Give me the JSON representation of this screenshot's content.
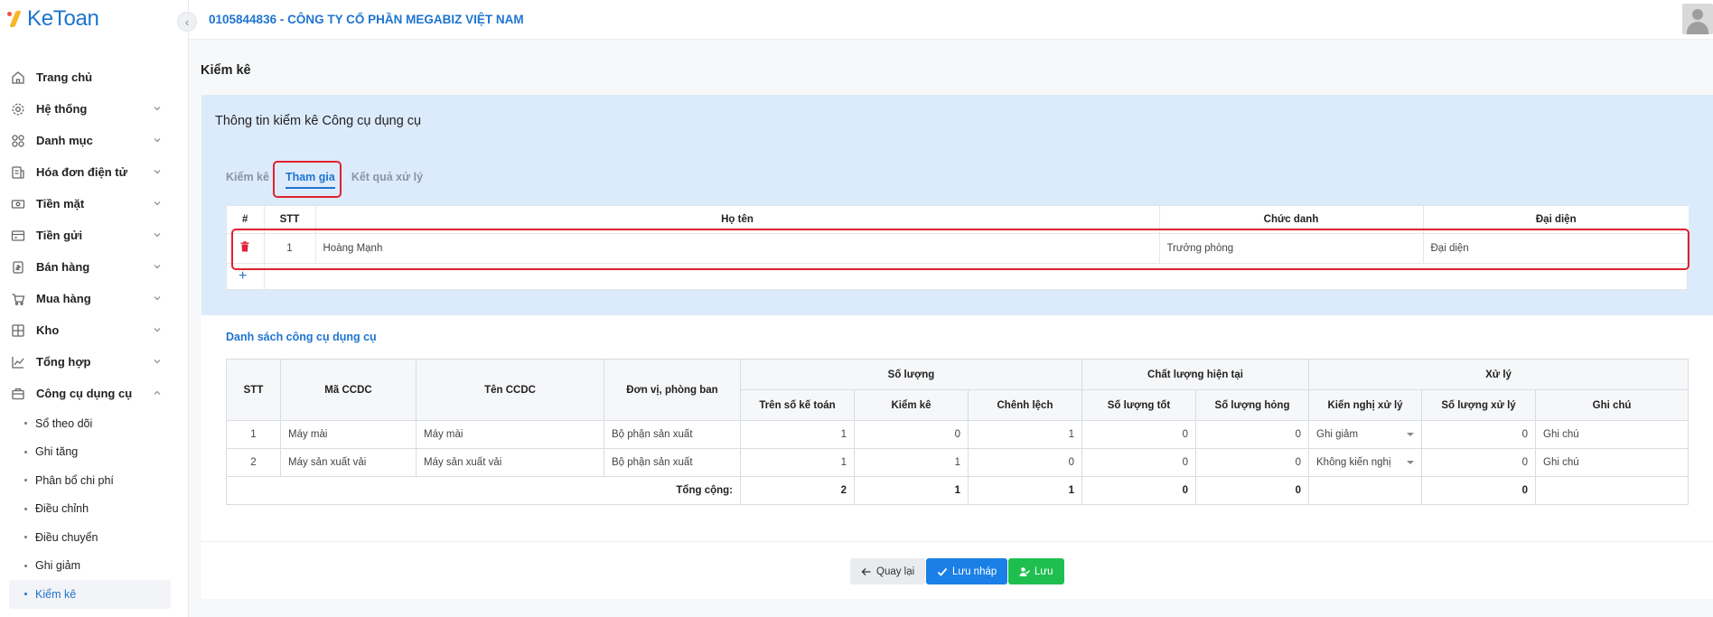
{
  "app": {
    "logo_text": "KeToan",
    "company": "0105844836 - CÔNG TY CỔ PHẦN MEGABIZ VIỆT NAM"
  },
  "colors": {
    "primary": "#1e74d0",
    "highlight": "#e0222d",
    "save": "#1fbf4f",
    "danger": "#e0223a"
  },
  "sidebar": {
    "items": [
      {
        "label": "Trang chủ",
        "icon": "home-icon"
      },
      {
        "label": "Hệ thống",
        "icon": "gear-icon"
      },
      {
        "label": "Danh mục",
        "icon": "grid-icon"
      },
      {
        "label": "Hóa đơn điện tử",
        "icon": "invoice-icon"
      },
      {
        "label": "Tiền mặt",
        "icon": "cash-icon"
      },
      {
        "label": "Tiền gửi",
        "icon": "card-icon"
      },
      {
        "label": "Bán hàng",
        "icon": "sale-icon"
      },
      {
        "label": "Mua hàng",
        "icon": "cart-icon"
      },
      {
        "label": "Kho",
        "icon": "warehouse-icon"
      },
      {
        "label": "Tổng hợp",
        "icon": "chart-icon"
      },
      {
        "label": "Công cụ dụng cụ",
        "icon": "tool-icon"
      }
    ],
    "sub_items": [
      "Sổ theo dõi",
      "Ghi tăng",
      "Phân bổ chi phí",
      "Điều chỉnh",
      "Điều chuyển",
      "Ghi giảm",
      "Kiểm kê"
    ]
  },
  "page": {
    "title": "Kiểm kê"
  },
  "info": {
    "title": "Thông tin kiểm kê Công cụ dụng cụ",
    "tabs": [
      "Kiểm kê",
      "Tham gia",
      "Kết quả xử lý"
    ],
    "participants": {
      "headers": [
        "#",
        "STT",
        "Họ tên",
        "Chức danh",
        "Đại diện"
      ],
      "rows": [
        {
          "stt": "1",
          "name": "Hoàng Mạnh",
          "title": "Trưởng phòng",
          "rep_placeholder": "Đại diện"
        }
      ],
      "add_label": "+"
    }
  },
  "tools": {
    "title": "Danh sách công cụ dụng cụ",
    "headers": {
      "stt": "STT",
      "code": "Mã CCDC",
      "name": "Tên CCDC",
      "dept": "Đơn vị, phòng ban",
      "qty_group": "Số lượng",
      "book": "Trên số kế toán",
      "counted": "Kiểm kê",
      "diff": "Chênh lệch",
      "quality_group": "Chất lượng hiện tại",
      "good": "Số lượng tốt",
      "broken": "Số lượng hỏng",
      "handle_group": "Xử lý",
      "proposal": "Kiến nghị xử lý",
      "handled": "Số lượng xử lý",
      "note": "Ghi chú"
    },
    "rows": [
      {
        "stt": "1",
        "code": "Máy mài",
        "name": "Máy mài",
        "dept": "Bộ phận sản xuất",
        "book": "1",
        "counted": "0",
        "diff": "1",
        "good": "0",
        "broken": "0",
        "proposal": "Ghi giảm",
        "handled": "0",
        "note_placeholder": "Ghi chú"
      },
      {
        "stt": "2",
        "code": "Máy sản xuất vải",
        "name": "Máy sản xuất vải",
        "dept": "Bộ phận sản xuất",
        "book": "1",
        "counted": "1",
        "diff": "0",
        "good": "0",
        "broken": "0",
        "proposal": "Không kiến nghị",
        "handled": "0",
        "note_placeholder": "Ghi chú"
      }
    ],
    "total": {
      "label": "Tổng cộng:",
      "book": "2",
      "counted": "1",
      "diff": "1",
      "good": "0",
      "broken": "0",
      "handled": "0"
    }
  },
  "footer": {
    "back": "Quay lại",
    "draft": "Lưu nháp",
    "save": "Lưu"
  }
}
